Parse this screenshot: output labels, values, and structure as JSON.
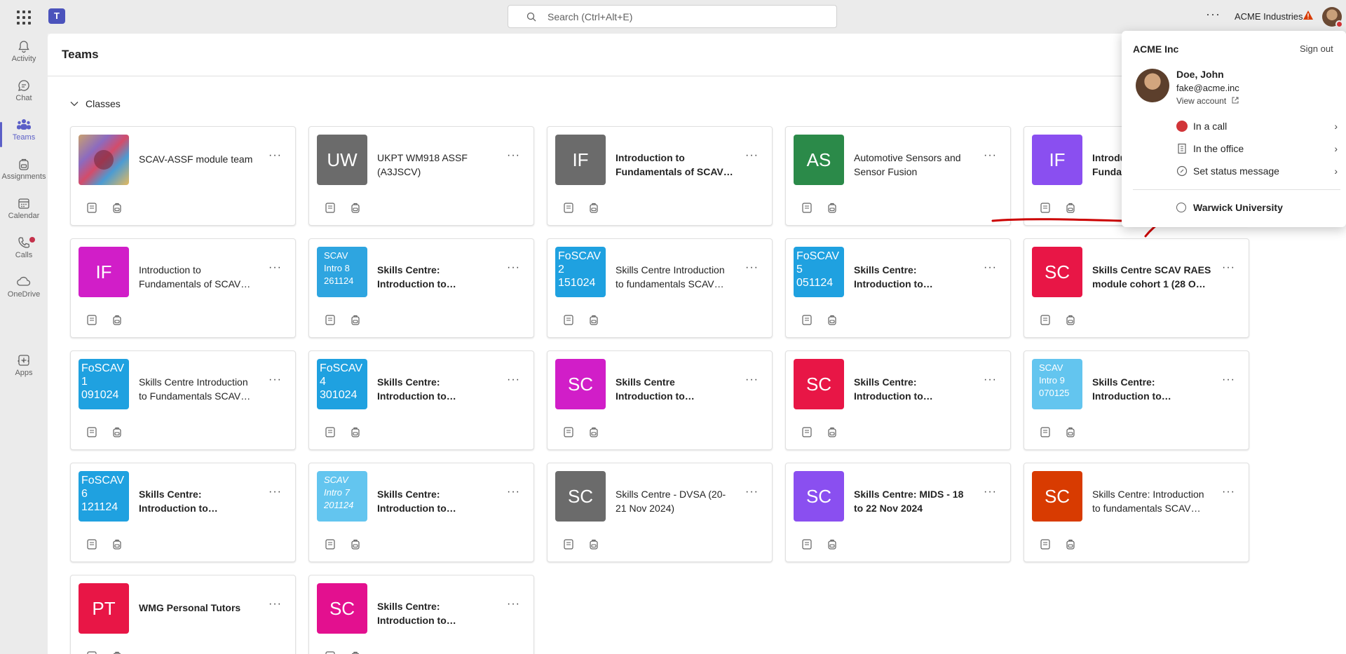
{
  "topbar": {
    "search_placeholder": "Search (Ctrl+Alt+E)",
    "org_name": "ACME Industries",
    "more": "···"
  },
  "rail": [
    {
      "label": "Activity",
      "icon": "bell-icon"
    },
    {
      "label": "Chat",
      "icon": "chat-icon"
    },
    {
      "label": "Teams",
      "icon": "teams-icon",
      "active": true
    },
    {
      "label": "Assignments",
      "icon": "backpack-icon"
    },
    {
      "label": "Calendar",
      "icon": "calendar-icon"
    },
    {
      "label": "Calls",
      "icon": "phone-icon"
    },
    {
      "label": "OneDrive",
      "icon": "cloud-icon"
    },
    {
      "label": "Apps",
      "icon": "apps-icon"
    }
  ],
  "rail_more": "···",
  "main": {
    "title": "Teams",
    "section": "Classes",
    "more": "···"
  },
  "cards": [
    {
      "tile": "",
      "tile_style": "photo",
      "name": "SCAV-ASSF module team",
      "bold": false
    },
    {
      "tile": "UW",
      "color": "#6b6b6b",
      "name": "UKPT WM918 ASSF (A3JSCV)",
      "bold": false
    },
    {
      "tile": "IF",
      "color": "#6b6b6b",
      "name": "Introduction to Fundamentals of SCAV…",
      "bold": true
    },
    {
      "tile": "AS",
      "color": "#2b8a49",
      "name": "Automotive Sensors and Sensor Fusion",
      "bold": false
    },
    {
      "tile": "IF",
      "color": "#8a4ff0",
      "name": "Introduction to Fundamentals of SCAV…",
      "bold": true
    },
    {
      "tile": "IF",
      "color": "#d11ec8",
      "name": "Introduction to Fundamentals of SCAV…",
      "bold": false
    },
    {
      "tile": "SCAV\nIntro 8\n261124",
      "tile_style": "txt small",
      "color": "#2ea5e0",
      "name": "Skills Centre: Introduction to…",
      "bold": true
    },
    {
      "tile": "FoSCAV\n2\n151024",
      "tile_style": "txt",
      "color": "#1fa1e0",
      "name": "Skills Centre Introduction to fundamentals SCAV…",
      "bold": false
    },
    {
      "tile": "FoSCAV\n5\n051124",
      "tile_style": "txt",
      "color": "#1fa1e0",
      "name": "Skills Centre: Introduction to…",
      "bold": true
    },
    {
      "tile": "SC",
      "color": "#e81646",
      "name": "Skills Centre SCAV RAES module cohort 1 (28 O…",
      "bold": true
    },
    {
      "tile": "FoSCAV\n1\n091024",
      "tile_style": "txt",
      "color": "#1fa1e0",
      "name": "Skills Centre Introduction to Fundamentals SCAV…",
      "bold": false
    },
    {
      "tile": "FoSCAV\n4\n301024",
      "tile_style": "txt",
      "color": "#1fa1e0",
      "name": "Skills Centre: Introduction to…",
      "bold": true
    },
    {
      "tile": "SC",
      "color": "#d11ec8",
      "name": "Skills Centre Introduction to…",
      "bold": true
    },
    {
      "tile": "SC",
      "color": "#e81646",
      "name": "Skills Centre: Introduction to…",
      "bold": true
    },
    {
      "tile": "SCAV\nIntro 9\n070125",
      "tile_style": "txt small",
      "color": "#63c5ef",
      "name": "Skills Centre: Introduction to…",
      "bold": true
    },
    {
      "tile": "FoSCAV\n6\n121124",
      "tile_style": "txt",
      "color": "#1fa1e0",
      "name": "Skills Centre: Introduction to…",
      "bold": true
    },
    {
      "tile": "SCAV\nIntro 7\n201124",
      "tile_style": "txt small italic",
      "color": "#63c5ef",
      "name": "Skills Centre: Introduction to…",
      "bold": true
    },
    {
      "tile": "SC",
      "color": "#6b6b6b",
      "name": "Skills Centre - DVSA (20-21 Nov 2024)",
      "bold": false
    },
    {
      "tile": "SC",
      "color": "#8a4ff0",
      "name": "Skills Centre: MIDS - 18 to 22 Nov 2024",
      "bold": true
    },
    {
      "tile": "SC",
      "color": "#d83b01",
      "name": "Skills Centre: Introduction to fundamentals SCAV…",
      "bold": false
    },
    {
      "tile": "PT",
      "color": "#e81646",
      "name": "WMG Personal Tutors",
      "bold": true
    },
    {
      "tile": "SC",
      "color": "#e3108f",
      "name": "Skills Centre: Introduction to…",
      "bold": true
    }
  ],
  "profile": {
    "org": "ACME Inc",
    "sign_out": "Sign out",
    "name": "Doe, John",
    "email": "fake@acme.inc",
    "view_account": "View account",
    "status": "In a call",
    "status_color": "#d13438",
    "location": "In the office",
    "set_status": "Set status message",
    "other_org": "Warwick University"
  },
  "annotation_color": "#cc0000"
}
